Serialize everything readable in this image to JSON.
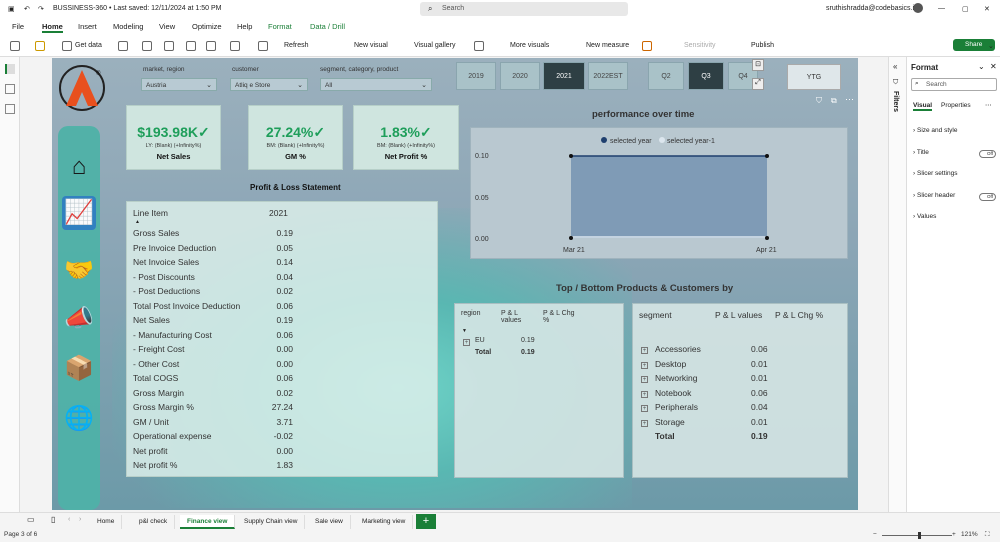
{
  "titlebar": {
    "file_title": "BUSSINESS-360 • Last saved: 12/11/2024 at 1:50 PM",
    "search_placeholder": "Search",
    "user_email": "sruthishradda@codebasics.in"
  },
  "menu": {
    "items": [
      "File",
      "Home",
      "Insert",
      "Modeling",
      "View",
      "Optimize",
      "Help",
      "Format",
      "Data / Drill"
    ],
    "active": "Home",
    "share_label": "Share"
  },
  "ribbon": {
    "get_data": "Get data",
    "refresh": "Refresh",
    "new_visual": "New visual",
    "visual_gallery": "Visual gallery",
    "more_visuals": "More visuals",
    "new_measure": "New measure",
    "sensitivity": "Sensitivity",
    "publish": "Publish"
  },
  "slicers": {
    "market_region": {
      "label": "market, region",
      "value": "Austria"
    },
    "customer": {
      "label": "customer",
      "value": "Atliq e Store"
    },
    "segment": {
      "label": "segment, category, product",
      "value": "All"
    }
  },
  "years": [
    "2019",
    "2020",
    "2021",
    "2022EST"
  ],
  "selected_year": "2021",
  "quarters": [
    "Q2",
    "Q3",
    "Q4"
  ],
  "selected_quarter": "Q3",
  "ytg_label": "YTG",
  "kpis": [
    {
      "value": "$193.98K",
      "sub": "LY: (Blank) (+Infinity%)",
      "name": "Net Sales"
    },
    {
      "value": "27.24%",
      "sub": "BM: (Blank) (+Infinity%)",
      "name": "GM %"
    },
    {
      "value": "1.83%",
      "sub": "BM: (Blank) (+Infinity%)",
      "name": "Net Profit %"
    }
  ],
  "pl": {
    "title": "Profit & Loss Statement",
    "col_line_item": "Line Item",
    "col_year": "2021",
    "rows": [
      {
        "label": "Gross Sales",
        "value": "0.19"
      },
      {
        "label": "Pre Invoice Deduction",
        "value": "0.05"
      },
      {
        "label": "Net Invoice Sales",
        "value": "0.14"
      },
      {
        "label": "- Post Discounts",
        "value": "0.04"
      },
      {
        "label": "- Post Deductions",
        "value": "0.02"
      },
      {
        "label": "Total Post Invoice Deduction",
        "value": "0.06"
      },
      {
        "label": "Net Sales",
        "value": "0.19"
      },
      {
        "label": "- Manufacturing Cost",
        "value": "0.06"
      },
      {
        "label": "- Freight Cost",
        "value": "0.00"
      },
      {
        "label": "- Other Cost",
        "value": "0.00"
      },
      {
        "label": "Total COGS",
        "value": "0.06"
      },
      {
        "label": "Gross Margin",
        "value": "0.02"
      },
      {
        "label": "Gross Margin %",
        "value": "27.24"
      },
      {
        "label": "GM / Unit",
        "value": "3.71"
      },
      {
        "label": "Operational expense",
        "value": "-0.02"
      },
      {
        "label": "Net profit",
        "value": "0.00"
      },
      {
        "label": "Net profit %",
        "value": "1.83"
      }
    ]
  },
  "chart_data": {
    "type": "area",
    "title": "performance over time",
    "x": [
      "Mar 21",
      "Apr 21"
    ],
    "series": [
      {
        "name": "selected year",
        "values": [
          0.1,
          0.1
        ],
        "color": "#1f3f6e"
      },
      {
        "name": "selected year-1",
        "values": [
          0.0,
          0.0
        ],
        "color": "#dce6ee"
      }
    ],
    "y_ticks": [
      "0.10",
      "0.05",
      "0.00"
    ],
    "ylim": [
      0,
      0.1
    ],
    "legend": "top-center",
    "grid": false
  },
  "topbottom": {
    "title": "Top / Bottom Products & Customers by",
    "region_table": {
      "headers": [
        "region",
        "P & L values",
        "P & L Chg %"
      ],
      "rows": [
        {
          "label": "EU",
          "value": "0.19"
        }
      ],
      "total_label": "Total",
      "total_value": "0.19"
    },
    "segment_table": {
      "headers": [
        "segment",
        "P & L values",
        "P & L Chg %"
      ],
      "rows": [
        {
          "label": "Accessories",
          "value": "0.06"
        },
        {
          "label": "Desktop",
          "value": "0.01"
        },
        {
          "label": "Networking",
          "value": "0.01"
        },
        {
          "label": "Notebook",
          "value": "0.06"
        },
        {
          "label": "Peripherals",
          "value": "0.04"
        },
        {
          "label": "Storage",
          "value": "0.01"
        }
      ],
      "total_label": "Total",
      "total_value": "0.19"
    }
  },
  "filters_label": "Filters",
  "format_pane": {
    "title": "Format",
    "search_placeholder": "Search",
    "tab_visual": "Visual",
    "tab_properties": "Properties",
    "sections": [
      {
        "label": "Size and style",
        "toggle": ""
      },
      {
        "label": "Title",
        "toggle": "Off"
      },
      {
        "label": "Slicer settings",
        "toggle": ""
      },
      {
        "label": "Slicer header",
        "toggle": "Off"
      },
      {
        "label": "Values",
        "toggle": ""
      }
    ]
  },
  "pages": [
    "Home",
    "p&l check",
    "Finance view",
    "Supply Chain view",
    "Sale view",
    "Marketing view"
  ],
  "selected_page": "Finance view",
  "status": {
    "page_info": "Page 3 of 6",
    "zoom": "121%"
  },
  "colors": {
    "accent": "#1a7f37",
    "kpi_value": "#1e9e5a",
    "nav": "#4fb2a8",
    "selected_year": "#2e3f44"
  }
}
